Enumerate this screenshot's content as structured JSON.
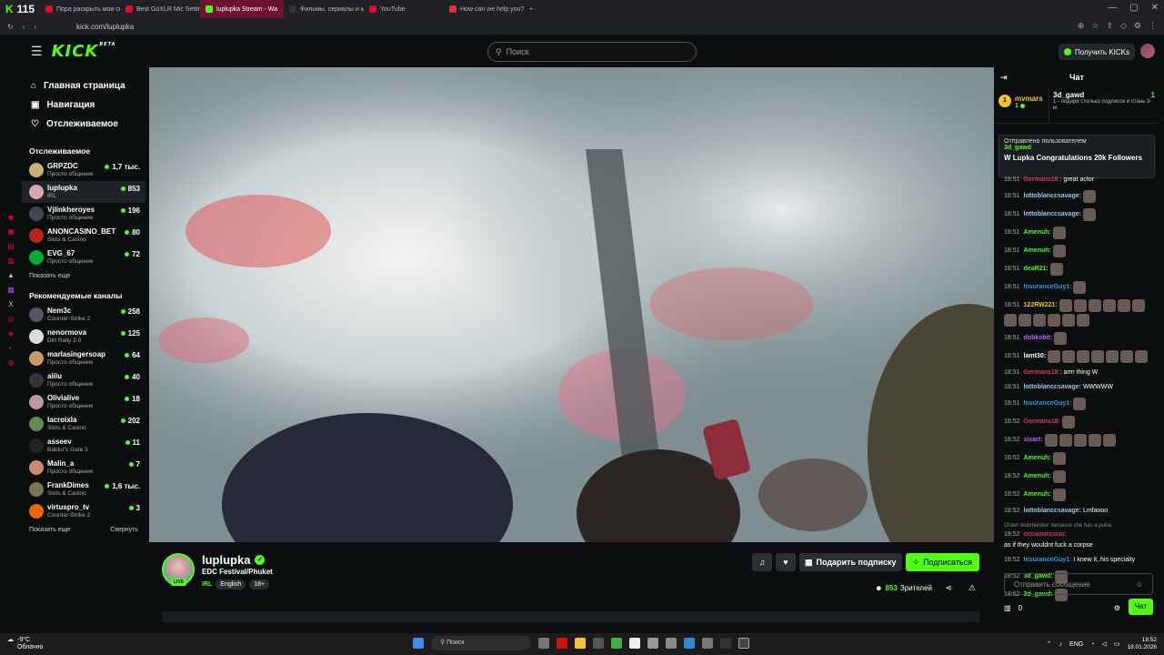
{
  "browser": {
    "logo": "115",
    "tabs": [
      {
        "label": "Пора раскрыть мои секр",
        "color": "#e03"
      },
      {
        "label": "Best GoXLR Mic Settings",
        "color": "#e03"
      },
      {
        "label": "luplupka Stream - Wa",
        "color": "#53fc18",
        "active": true
      },
      {
        "label": "Фильмы, сериалы и муль",
        "color": "#333"
      },
      {
        "label": "YouTube",
        "color": "#e03"
      },
      {
        "label": "How can we help you? - O",
        "color": "#d33"
      }
    ],
    "url": "kick.com/luplupka"
  },
  "header": {
    "logo": "KICK",
    "beta": "BETA",
    "search_placeholder": "Поиск",
    "kicks_label": "Получить KICKs"
  },
  "sidebar": {
    "nav": [
      {
        "label": "Главная страница",
        "icon": "home-icon"
      },
      {
        "label": "Навигация",
        "icon": "compass-icon"
      },
      {
        "label": "Отслеживаемое",
        "icon": "heart-icon"
      }
    ],
    "following_title": "Отслеживаемое",
    "following": [
      {
        "name": "GRPZDC",
        "cat": "Просто общение",
        "count": "1,7 тыс.",
        "color": "#c9b27a"
      },
      {
        "name": "luplupka",
        "cat": "IRL",
        "count": "853",
        "color": "#d9a8b0",
        "selected": true
      },
      {
        "name": "Vjlinkheroyes",
        "cat": "Просто общение",
        "count": "196",
        "color": "#445"
      },
      {
        "name": "ANONCASINO_BET",
        "cat": "Slots & Casino",
        "count": "80",
        "color": "#b22"
      },
      {
        "name": "EVG_67",
        "cat": "Просто общение",
        "count": "72",
        "color": "#0a3"
      }
    ],
    "show_more": "Показать еще",
    "recommended_title": "Рекомендуемые каналы",
    "recommended": [
      {
        "name": "Nem3c",
        "cat": "Counter-Strike 2",
        "count": "258",
        "color": "#556"
      },
      {
        "name": "nenormova",
        "cat": "Dirt Rally 2.0",
        "count": "125",
        "color": "#ddd"
      },
      {
        "name": "marlasingersoap",
        "cat": "Просто общение",
        "count": "64",
        "color": "#c96"
      },
      {
        "name": "aiiiu",
        "cat": "Просто общение",
        "count": "40",
        "color": "#333"
      },
      {
        "name": "Olivialive",
        "cat": "Просто общение",
        "count": "18",
        "color": "#b9a"
      },
      {
        "name": "lacroixla",
        "cat": "Slots & Casino",
        "count": "202",
        "color": "#685"
      },
      {
        "name": "asseev",
        "cat": "Baldur's Gate 3",
        "count": "11",
        "color": "#222"
      },
      {
        "name": "Malin_a",
        "cat": "Просто общение",
        "count": "7",
        "color": "#c87"
      },
      {
        "name": "FrankDimes",
        "cat": "Slots & Casino",
        "count": "1,6 тыс.",
        "color": "#775"
      },
      {
        "name": "virtuspro_tv",
        "cat": "Counter-Strike 2",
        "count": "3",
        "color": "#e60"
      }
    ],
    "show_more2": "Показать еще",
    "collapse": "Свернуть"
  },
  "stream": {
    "streamer": "luplupka",
    "title": "EDC Festival/Phuket",
    "category": "IRL",
    "tags": [
      "English",
      "18+"
    ],
    "live": "LIVE",
    "gift_sub": "Подарить подписку",
    "subscribe": "Подписаться",
    "viewers": "853",
    "viewers_label": "Зрителей"
  },
  "chat": {
    "title": "Чат",
    "top_gifter": {
      "name": "mvmars",
      "rank": "1",
      "count": "1"
    },
    "second": {
      "name": "3d_gawd",
      "count": "1",
      "note": "1 - подари столько подписок и стань 3-м"
    },
    "pinned_by": "Отправлено пользователем",
    "pinned_user": "3d_gawd",
    "pinned_msg": "W Lupka Congratulations 20k Followers",
    "messages": [
      {
        "t": "18:51",
        "u": "Germans18",
        "c": "#e0346e",
        "m": ": great actor",
        "e": 0
      },
      {
        "t": "18:51",
        "u": "lottoblanccsavage:",
        "c": "#9fc5e8",
        "m": "",
        "e": 1
      },
      {
        "t": "18:51",
        "u": "lottoblanccsavage:",
        "c": "#9fc5e8",
        "m": "",
        "e": 1
      },
      {
        "t": "18:51",
        "u": "Amenuh:",
        "c": "#53fc18",
        "m": "",
        "e": 1
      },
      {
        "t": "18:51",
        "u": "Amenuh:",
        "c": "#53fc18",
        "m": "",
        "e": 1
      },
      {
        "t": "18:51",
        "u": "deaR21:",
        "c": "#53fc18",
        "m": "",
        "e": 1
      },
      {
        "t": "18:51",
        "u": "InsuranceGuy1:",
        "c": "#2d9cdb",
        "m": "",
        "e": 1
      },
      {
        "t": "18:51",
        "u": "122RW221:",
        "c": "#f2c230",
        "m": "",
        "e": 12
      },
      {
        "t": "18:51",
        "u": "dobkobit:",
        "c": "#b266ff",
        "m": "",
        "e": 1
      },
      {
        "t": "18:51",
        "u": "lamt30:",
        "c": "#fff",
        "m": "",
        "e": 7
      },
      {
        "t": "18:51",
        "u": "Germans18",
        "c": "#e0346e",
        "m": ": arm thing W",
        "e": 0
      },
      {
        "t": "18:51",
        "u": "lottoblanccsavage:",
        "c": "#9fc5e8",
        "m": " WWWWW",
        "e": 0
      },
      {
        "t": "18:51",
        "u": "InsuranceGuy1:",
        "c": "#2d9cdb",
        "m": "",
        "e": 1
      },
      {
        "t": "18:52",
        "u": "Germans18:",
        "c": "#e0346e",
        "m": "",
        "e": 1
      },
      {
        "t": "18:52",
        "u": "sixart:",
        "c": "#b266ff",
        "m": "",
        "e": 5
      },
      {
        "t": "18:52",
        "u": "Amenuh:",
        "c": "#53fc18",
        "m": "",
        "e": 1
      },
      {
        "t": "18:52",
        "u": "Amenuh:",
        "c": "#53fc18",
        "m": "",
        "e": 1
      },
      {
        "t": "18:52",
        "u": "Amenuh:",
        "c": "#53fc18",
        "m": "",
        "e": 1
      },
      {
        "t": "18:52",
        "u": "lottoblanccsavage:",
        "c": "#9fc5e8",
        "m": " Lmfaooo",
        "e": 0
      }
    ],
    "reply_note": "Ответ klobmeister: because she has a pulse",
    "reply_msg": {
      "t": "18:52",
      "u": "cccuuuccuuu:",
      "c": "#e0346e",
      "m": " as if they wouldnt fuck a corpse"
    },
    "messages2": [
      {
        "t": "18:52",
        "u": "InsuranceGuy1:",
        "c": "#2d9cdb",
        "m": " I knew it, his specialty",
        "e": 0
      },
      {
        "t": "18:52",
        "u": "3d_gawd:",
        "c": "#53fc18",
        "m": "",
        "e": 1
      },
      {
        "t": "18:52",
        "u": "3d_gawd:",
        "c": "#53fc18",
        "m": "",
        "e": 1
      }
    ],
    "input_placeholder": "Отправить сообщение",
    "kicks_count": "0",
    "send": "Чат"
  },
  "taskbar": {
    "temp": "-9°C",
    "weather": "Облачно",
    "search": "Поиск",
    "lang": "ENG",
    "time": "18:52",
    "date": "18.01.2026"
  }
}
